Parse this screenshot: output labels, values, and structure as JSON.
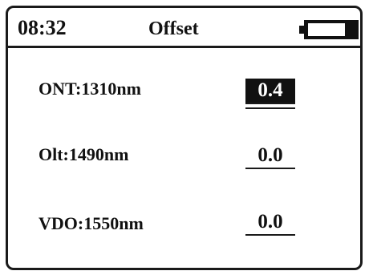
{
  "header": {
    "time": "08:32",
    "title": "Offset",
    "battery": {
      "level_percent": 20,
      "icon": "battery-icon"
    }
  },
  "rows": [
    {
      "label": "ONT:1310nm",
      "value": "0.4",
      "selected": true
    },
    {
      "label": "Olt:1490nm",
      "value": "0.0",
      "selected": false
    },
    {
      "label": "VDO:1550nm",
      "value": "0.0",
      "selected": false
    }
  ],
  "colors": {
    "foreground": "#111111",
    "background": "#ffffff",
    "selected_background": "#111111",
    "selected_text": "#ffffff"
  }
}
